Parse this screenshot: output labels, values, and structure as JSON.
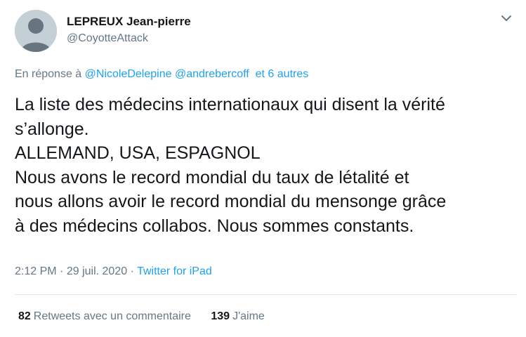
{
  "author": {
    "display_name": "LEPREUX Jean-pierre",
    "handle": "@CoyotteAttack"
  },
  "reply": {
    "prefix": "En réponse à",
    "mention1": "@NicoleDelepine",
    "mention2": "@andrebercoff",
    "others": "et 6 autres"
  },
  "tweet_lines": [
    "La liste des médecins internationaux qui disent la vérité",
    "s’allonge.",
    "ALLEMAND, USA, ESPAGNOL",
    "Nous avons le record mondial du taux de létalité et",
    "nous allons avoir le record mondial du mensonge grâce",
    "à des médecins collabos. Nous sommes constants."
  ],
  "meta": {
    "time": "2:12 PM",
    "date": "29 juil. 2020",
    "separator": "·",
    "source": "Twitter for iPad"
  },
  "stats": {
    "retweets_count": "82",
    "retweets_label": "Retweets avec un commentaire",
    "likes_count": "139",
    "likes_label": "J'aime"
  },
  "colors": {
    "link": "#1da1f2",
    "secondary_text": "#657786",
    "primary_text": "#14171a"
  },
  "icons": {
    "avatar": "default-profile-silhouette",
    "menu": "chevron-down-icon"
  }
}
